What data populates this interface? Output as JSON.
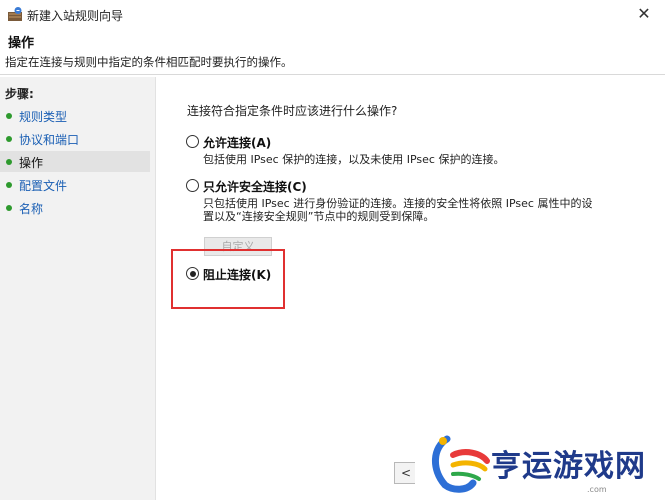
{
  "window": {
    "title": "新建入站规则向导",
    "close_glyph": "✕"
  },
  "header": {
    "title": "操作",
    "description": "指定在连接与规则中指定的条件相匹配时要执行的操作。"
  },
  "sidebar": {
    "title": "步骤:",
    "items": [
      {
        "label": "规则类型",
        "active": false
      },
      {
        "label": "协议和端口",
        "active": false
      },
      {
        "label": "操作",
        "active": true
      },
      {
        "label": "配置文件",
        "active": false
      },
      {
        "label": "名称",
        "active": false
      }
    ]
  },
  "main": {
    "question": "连接符合指定条件时应该进行什么操作?",
    "options": [
      {
        "label": "允许连接(A)",
        "description": "包括使用 IPsec 保护的连接，以及未使用 IPsec 保护的连接。",
        "checked": false
      },
      {
        "label": "只允许安全连接(C)",
        "description_line1": "只包括使用 IPsec 进行身份验证的连接。连接的安全性将依照 IPsec 属性中的设",
        "description_line2": "置以及“连接安全规则”节点中的规则受到保障。",
        "checked": false
      },
      {
        "label": "阻止连接(K)",
        "checked": true
      }
    ],
    "custom_button": "自定义",
    "back_button": "<"
  },
  "watermark": {
    "text": "亨运游戏网",
    "sub": ".com"
  },
  "colors": {
    "step_dot": "#2e9a2e",
    "step_link": "#1a5fb4",
    "highlight": "#e03030",
    "watermark": "#1f3a8a"
  }
}
